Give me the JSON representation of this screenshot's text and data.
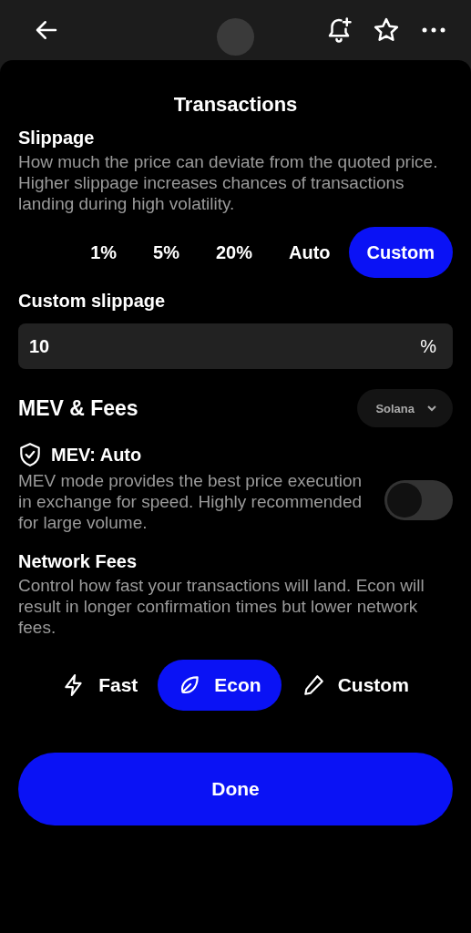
{
  "title": "Transactions",
  "slippage": {
    "heading": "Slippage",
    "description": "How much the price can deviate from the quoted price. Higher slippage increases chances of transactions landing during high volatility.",
    "options": [
      {
        "label": "1%",
        "selected": false
      },
      {
        "label": "5%",
        "selected": false
      },
      {
        "label": "20%",
        "selected": false
      },
      {
        "label": "Auto",
        "selected": false
      },
      {
        "label": "Custom",
        "selected": true
      }
    ]
  },
  "custom_slippage": {
    "label": "Custom slippage",
    "value": "10",
    "unit": "%"
  },
  "mev_fees": {
    "heading": "MEV & Fees",
    "network": "Solana"
  },
  "mev": {
    "heading": "MEV: Auto",
    "description": "MEV mode provides the best price execution in exchange for speed. Highly recommended for large volume.",
    "on": false
  },
  "network_fees": {
    "heading": "Network Fees",
    "description": "Control how fast your transactions will land. Econ will result in longer confirmation times but lower network fees.",
    "options": [
      {
        "label": "Fast",
        "kind": "bolt",
        "selected": false
      },
      {
        "label": "Econ",
        "kind": "leaf",
        "selected": true
      },
      {
        "label": "Custom",
        "kind": "pencil",
        "selected": false
      }
    ]
  },
  "done": "Done"
}
